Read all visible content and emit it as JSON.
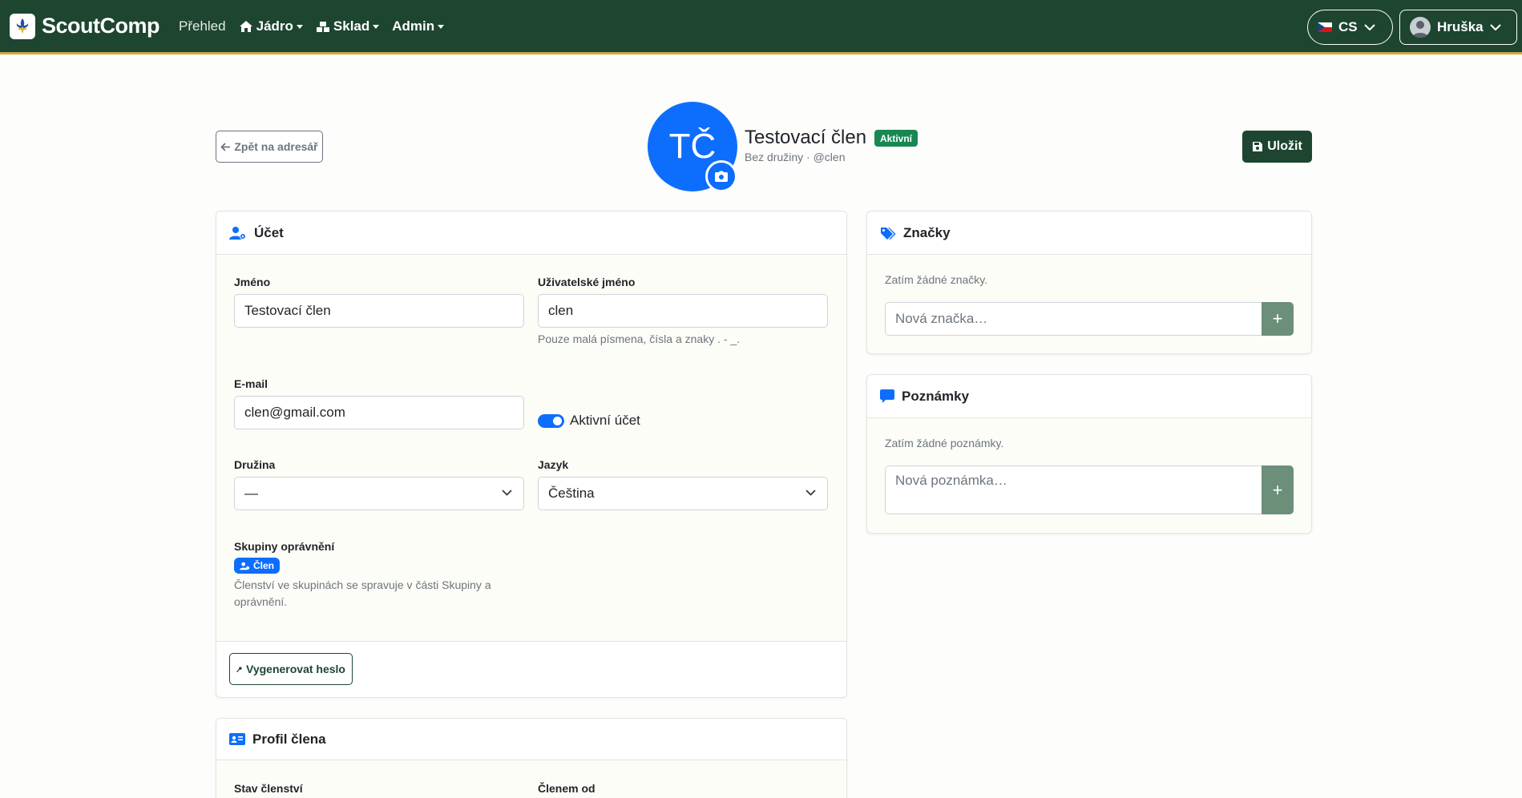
{
  "app": {
    "brand": "ScoutComp",
    "nav": [
      {
        "label": "Přehled",
        "icon": ""
      },
      {
        "label": "Jádro",
        "icon": "home-icon"
      },
      {
        "label": "Sklad",
        "icon": "warehouse-icon"
      },
      {
        "label": "Admin",
        "icon": ""
      }
    ],
    "language": "CS",
    "user": "Hruška"
  },
  "header": {
    "back_label": "Zpět na adresář",
    "initials": "TČ",
    "name": "Testovací člen",
    "status": "Aktivní",
    "subtitle": "Bez družiny · @clen",
    "save_label": "Uložit"
  },
  "account_card": {
    "title": "Účet",
    "name_label": "Jméno",
    "name_value": "Testovací člen",
    "username_label": "Uživatelské jméno",
    "username_value": "clen",
    "username_help": "Pouze malá písmena, čísla a znaky . - _.",
    "email_label": "E-mail",
    "email_value": "clen@gmail.com",
    "active_label": "Aktivní účet",
    "active": true,
    "patrol_label": "Družina",
    "patrol_value": "—",
    "language_label": "Jazyk",
    "language_value": "Čeština",
    "groups_label": "Skupiny oprávnění",
    "groups": [
      "Člen"
    ],
    "groups_help": "Členství ve skupinách se spravuje v části Skupiny a oprávnění.",
    "generate_password_label": "Vygenerovat heslo"
  },
  "profile_card": {
    "title": "Profil člena",
    "membership_status_label": "Stav členství",
    "member_since_label": "Členem od"
  },
  "tags_card": {
    "title": "Značky",
    "empty_text": "Zatím žádné značky.",
    "input_placeholder": "Nová značka…",
    "add_label": "+"
  },
  "notes_card": {
    "title": "Poznámky",
    "empty_text": "Zatím žádné poznámky.",
    "input_placeholder": "Nová poznámka…",
    "add_label": "+"
  },
  "colors": {
    "navbar": "#1d4530",
    "navbar_border": "#d9a441",
    "primary": "#0d6efd",
    "success": "#198754",
    "muted_green": "#6b8f79"
  }
}
